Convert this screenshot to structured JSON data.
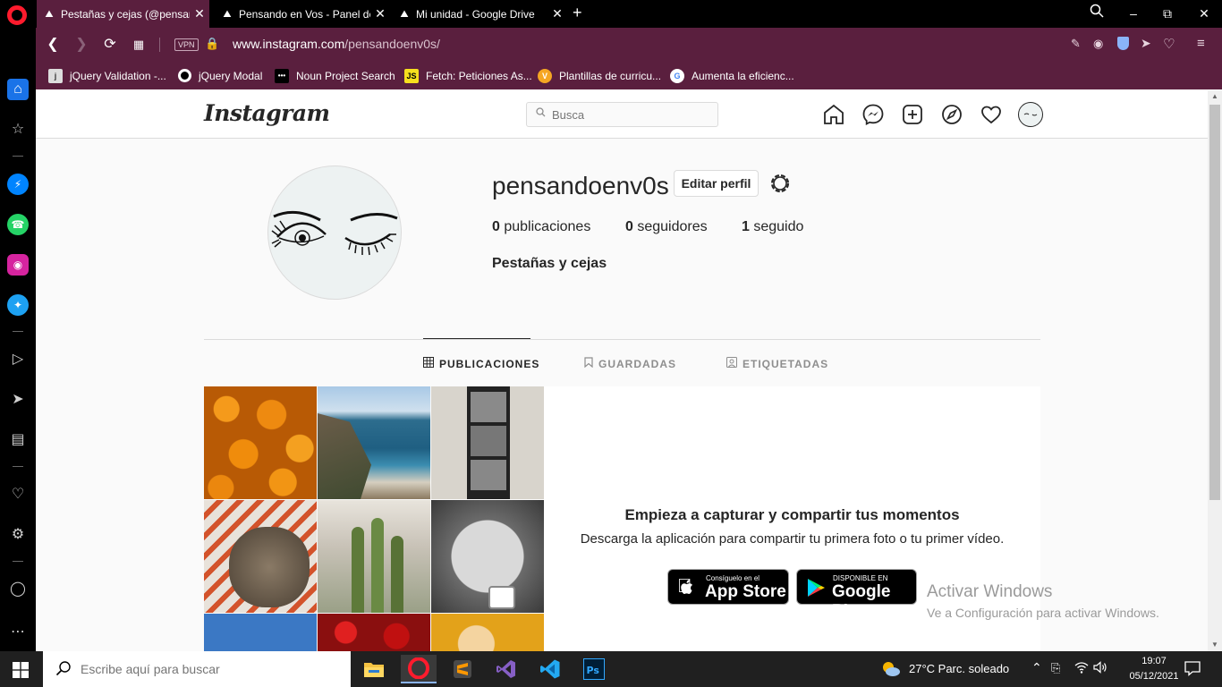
{
  "browser": {
    "tabs": [
      {
        "label": "Pestañas y cejas (@pensan",
        "active": true
      },
      {
        "label": "Pensando en Vos - Panel de",
        "active": false
      },
      {
        "label": "Mi unidad - Google Drive",
        "active": false
      }
    ],
    "new_tab": "+",
    "url_domain": "www.instagram.com",
    "url_path": "/pensandoenv0s/",
    "vpn_badge": "VPN",
    "bookmarks": [
      {
        "label": "jQuery Validation -...",
        "icon": "jquery-icon"
      },
      {
        "label": "jQuery Modal",
        "icon": "circle-icon"
      },
      {
        "label": "Noun Project Search",
        "icon": "noun-project-icon"
      },
      {
        "label": "Fetch: Peticiones As...",
        "icon": "js-icon"
      },
      {
        "label": "Plantillas de curricu...",
        "icon": "v-icon"
      },
      {
        "label": "Aumenta la eficienc...",
        "icon": "google-icon"
      }
    ]
  },
  "instagram": {
    "logo": "Instagram",
    "search_placeholder": "Busca",
    "profile": {
      "username": "pensandoenv0s",
      "edit_button": "Editar perfil",
      "posts_count": "0",
      "posts_label": "publicaciones",
      "followers_count": "0",
      "followers_label": "seguidores",
      "following_count": "1",
      "following_label": "seguido",
      "full_name": "Pestañas y cejas"
    },
    "tabs": [
      {
        "label": "PUBLICACIONES",
        "active": true
      },
      {
        "label": "GUARDADAS",
        "active": false
      },
      {
        "label": "ETIQUETADAS",
        "active": false
      }
    ],
    "empty_state": {
      "title": "Empieza a capturar y compartir tus momentos",
      "subtitle": "Descarga la aplicación para compartir tu primera foto o tu primer vídeo.",
      "app_store_small": "Consíguelo en el",
      "app_store_big": "App Store",
      "google_play_small": "DISPONIBLE EN",
      "google_play_big": "Google Play"
    }
  },
  "watermark": {
    "title": "Activar Windows",
    "subtitle": "Ve a Configuración para activar Windows."
  },
  "taskbar": {
    "search_placeholder": "Escribe aquí para buscar",
    "weather": "27°C  Parc. soleado",
    "time": "19:07",
    "date": "05/12/2021"
  },
  "colors": {
    "opera_bar": "#5a1f3e",
    "ig_border": "#dbdbdb",
    "text": "#262626"
  }
}
